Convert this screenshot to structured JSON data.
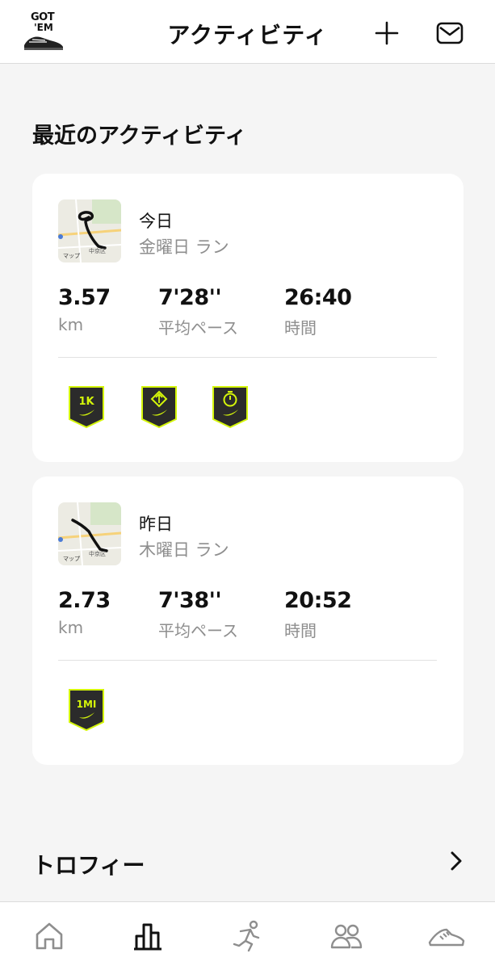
{
  "header": {
    "logo_line1": "GOT",
    "logo_line2": "'EM",
    "title": "アクティビティ",
    "add_icon": "plus-icon",
    "mail_icon": "mail-icon"
  },
  "section": {
    "title": "最近のアクティビティ"
  },
  "activities": [
    {
      "day": "今日",
      "subtitle": "金曜日 ラン",
      "map_label": "マップ",
      "map_place": "中京区",
      "distance": "3.57",
      "distance_unit": "km",
      "pace": "7'28''",
      "pace_label": "平均ペース",
      "time": "26:40",
      "time_label": "時間",
      "badges": [
        {
          "text": "1K",
          "icon": "badge-1k-icon"
        },
        {
          "text": "",
          "icon": "badge-arrow-icon"
        },
        {
          "text": "",
          "icon": "badge-stopwatch-icon"
        }
      ]
    },
    {
      "day": "昨日",
      "subtitle": "木曜日 ラン",
      "map_label": "マップ",
      "map_place": "中京区",
      "distance": "2.73",
      "distance_unit": "km",
      "pace": "7'38''",
      "pace_label": "平均ペース",
      "time": "20:52",
      "time_label": "時間",
      "badges": [
        {
          "text": "1MI",
          "icon": "badge-1mi-icon"
        }
      ]
    }
  ],
  "trophies": {
    "label": "トロフィー",
    "icon": "chevron-right-icon"
  },
  "colors": {
    "badge_bg": "#2b2b2b",
    "badge_accent": "#d4f50a",
    "muted_text": "#8e8e8e"
  },
  "tabs": [
    {
      "icon": "home-icon"
    },
    {
      "icon": "activity-chart-icon",
      "active": true
    },
    {
      "icon": "runner-icon"
    },
    {
      "icon": "community-icon"
    },
    {
      "icon": "shoe-icon"
    }
  ]
}
